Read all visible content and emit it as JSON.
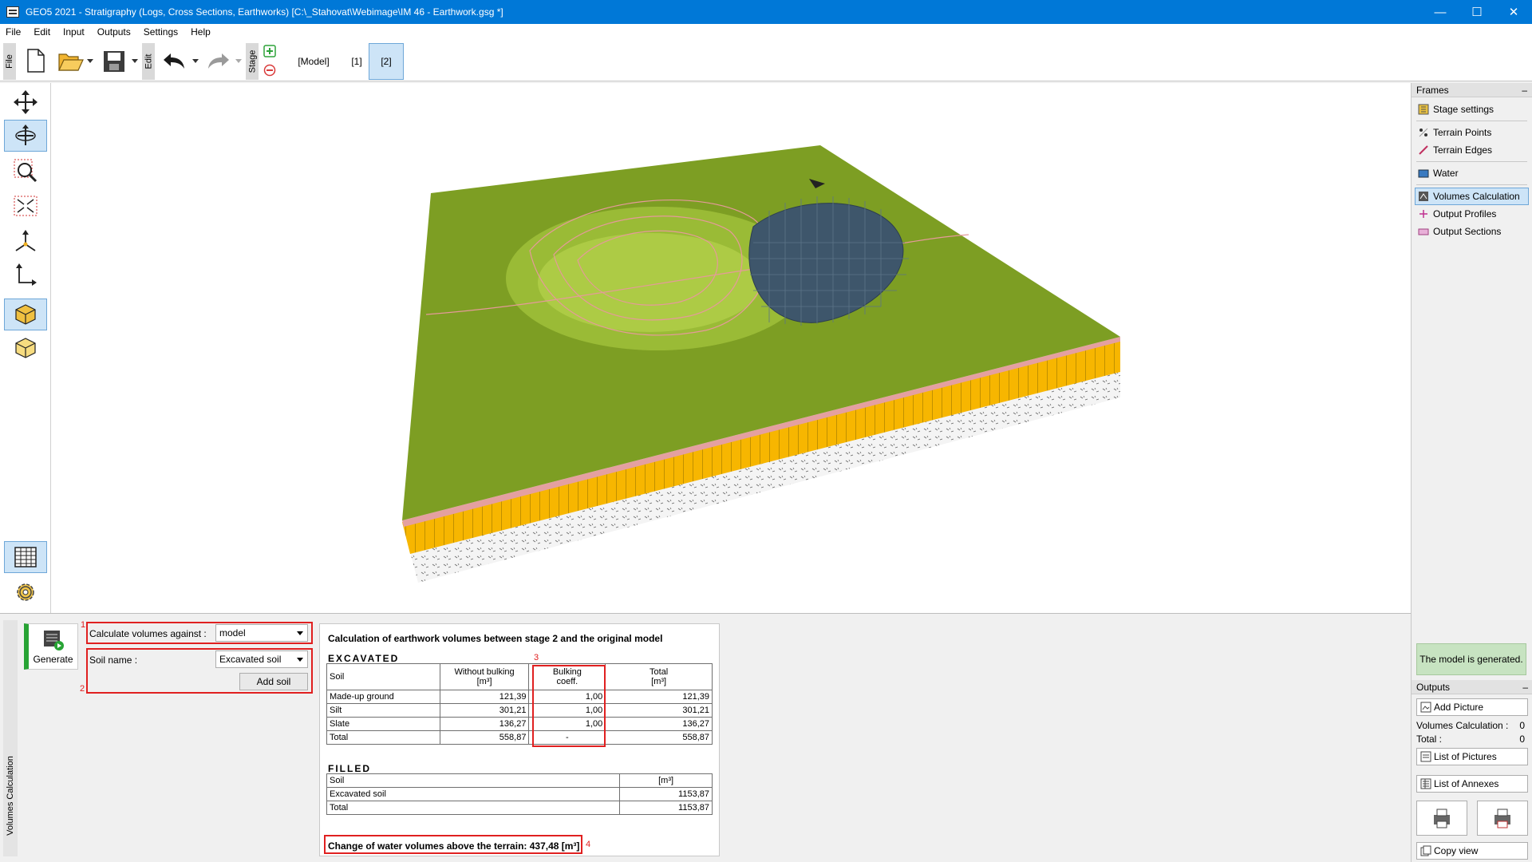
{
  "window": {
    "title": "GEO5 2021 - Stratigraphy (Logs, Cross Sections, Earthworks) [C:\\_Stahovat\\Webimage\\IM 46 - Earthwork.gsg *]",
    "minimize": "—",
    "maximize": "☐",
    "close": "✕"
  },
  "menu": [
    "File",
    "Edit",
    "Input",
    "Outputs",
    "Settings",
    "Help"
  ],
  "toolbar": {
    "file_label": "File",
    "edit_label": "Edit",
    "stage_label": "Stage",
    "stages": [
      "[Model]",
      "[1]",
      "[2]"
    ],
    "active_stage": "[2]"
  },
  "frames": {
    "header": "Frames",
    "collapse": "–",
    "items": [
      "Stage settings",
      "Terrain Points",
      "Terrain Edges",
      "Water",
      "Volumes Calculation",
      "Output Profiles",
      "Output Sections"
    ],
    "active": "Volumes Calculation"
  },
  "status": "The model is generated.",
  "outputs": {
    "header": "Outputs",
    "collapse": "–",
    "add_picture": "Add Picture",
    "volumes_calc_label": "Volumes Calculation :",
    "volumes_calc_value": "0",
    "total_label": "Total :",
    "total_value": "0",
    "list_pictures": "List of Pictures",
    "list_annexes": "List of Annexes",
    "copy_view": "Copy view"
  },
  "bottom": {
    "side_tab": "Volumes Calculation",
    "generate": "Generate",
    "calc_against_label": "Calculate volumes against :",
    "calc_against_value": "model",
    "soil_name_label": "Soil name :",
    "soil_name_value": "Excavated soil",
    "add_soil": "Add soil",
    "markers": [
      "1",
      "2",
      "3",
      "4"
    ]
  },
  "results": {
    "title": "Calculation of earthwork volumes between stage 2 and the original model",
    "excavated_title": "EXCAVATED",
    "excavated_headers": {
      "soil": "Soil",
      "without_bulking": "Without bulking",
      "without_bulking_unit": "[m³]",
      "bulking": "Bulking",
      "bulking_unit": "coeff.",
      "total": "Total",
      "total_unit": "[m³]"
    },
    "excavated_rows": [
      {
        "soil": "Made-up ground",
        "without": "121,39",
        "coeff": "1,00",
        "total": "121,39"
      },
      {
        "soil": "Silt",
        "without": "301,21",
        "coeff": "1,00",
        "total": "301,21"
      },
      {
        "soil": "Slate",
        "without": "136,27",
        "coeff": "1,00",
        "total": "136,27"
      }
    ],
    "excavated_total": {
      "label": "Total",
      "without": "558,87",
      "coeff": "-",
      "total": "558,87"
    },
    "filled_title": "FILLED",
    "filled_headers": {
      "soil": "Soil",
      "unit": "[m³]"
    },
    "filled_rows": [
      {
        "soil": "Excavated soil",
        "value": "1153,87"
      }
    ],
    "filled_total": {
      "label": "Total",
      "value": "1153,87"
    },
    "water_change": "Change of water volumes above the terrain: 437,48 [m³]"
  }
}
